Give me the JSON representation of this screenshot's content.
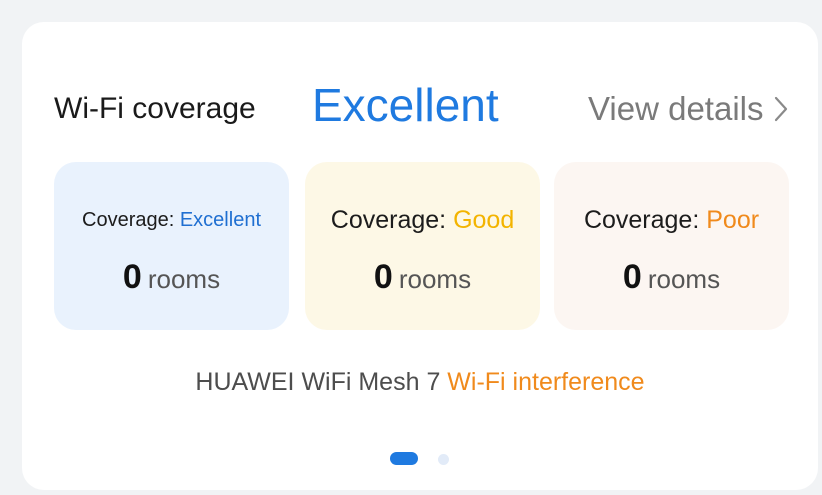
{
  "header": {
    "title": "Wi-Fi coverage",
    "status": "Excellent",
    "link_label": "View details",
    "link_icon": "chevron-right-icon"
  },
  "tiles": [
    {
      "coverage_label": "Coverage: ",
      "coverage_value": "Excellent",
      "count": "0",
      "unit": "rooms"
    },
    {
      "coverage_label": "Coverage: ",
      "coverage_value": "Good",
      "count": "0",
      "unit": "rooms"
    },
    {
      "coverage_label": "Coverage: ",
      "coverage_value": "Poor",
      "count": "0",
      "unit": "rooms"
    }
  ],
  "footer": {
    "device": "HUAWEI WiFi Mesh 7",
    "warning": "Wi-Fi interference"
  },
  "pager": {
    "current": 1,
    "total": 2
  },
  "colors": {
    "excellent": "#1f7ae0",
    "good": "#f3b400",
    "poor": "#f08a1c",
    "excellent_bg": "#e9f2fd",
    "good_bg": "#fdf8e6",
    "poor_bg": "#fcf6f2"
  }
}
